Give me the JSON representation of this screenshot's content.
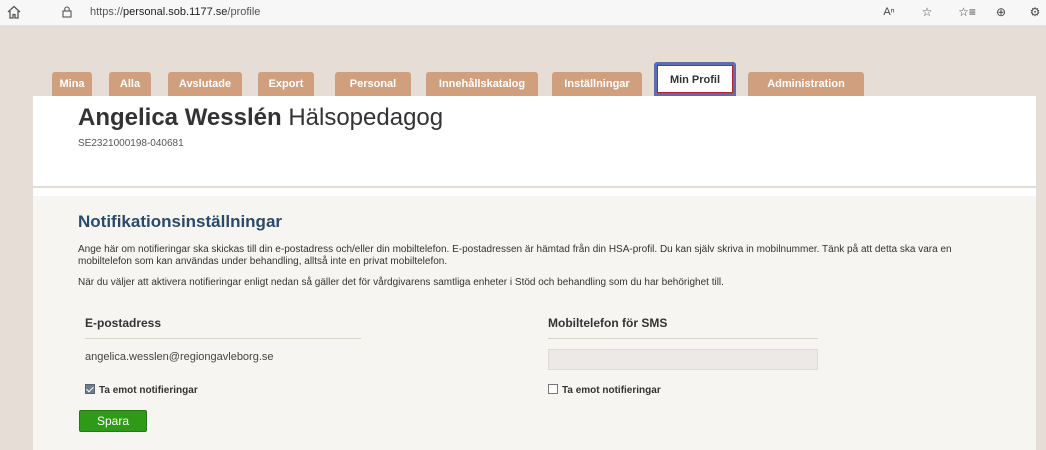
{
  "browser": {
    "url_prefix": "https://",
    "url_domain": "personal.sob.1177.se",
    "url_path": "/profile",
    "icons": [
      "home-icon",
      "lock-icon",
      "read-aloud-icon",
      "favorite-star-icon",
      "favorites-list-icon",
      "collections-icon",
      "extensions-icon"
    ]
  },
  "tabs": [
    {
      "label": "Mina",
      "active": false
    },
    {
      "label": "Alla",
      "active": false
    },
    {
      "label": "Avslutade",
      "active": false
    },
    {
      "label": "Export",
      "active": false
    },
    {
      "label": "Personal",
      "active": false
    },
    {
      "label": "Innehållskatalog",
      "active": false
    },
    {
      "label": "Inställningar",
      "active": false
    },
    {
      "label": "Min Profil",
      "active": true
    },
    {
      "label": "Administration",
      "active": false
    }
  ],
  "profile": {
    "name": "Angelica Wesslén",
    "role": "Hälsopedagog",
    "hsa_id": "SE2321000198-040681"
  },
  "notifications": {
    "title": "Notifikationsinställningar",
    "description": "Ange här om notifieringar ska skickas till din e-postadress och/eller din mobiltelefon. E-postadressen är hämtad från din HSA-profil. Du kan själv skriva in mobilnummer. Tänk på att detta ska vara en mobiltelefon som kan användas under behandling, alltså inte en privat mobiltelefon.",
    "description2": "När du väljer att aktivera notifieringar enligt nedan så gäller det för vårdgivarens samtliga enheter i Stöd och behandling som du har behörighet till.",
    "email_header": "E-postadress",
    "email_value": "angelica.wesslen@regiongavleborg.se",
    "email_checkbox_label": "Ta emot notifieringar",
    "email_checked": true,
    "sms_header": "Mobiltelefon för SMS",
    "sms_value": "",
    "sms_checkbox_label": "Ta emot notifieringar",
    "sms_checked": false,
    "save_label": "Spara"
  },
  "colors": {
    "page_bg": "#e5ddd6",
    "tab_bg": "#cf9f7e",
    "active_tab_border": "#5b6cb0",
    "section_title": "#2a4a6a",
    "save_button": "#2e9a17"
  }
}
